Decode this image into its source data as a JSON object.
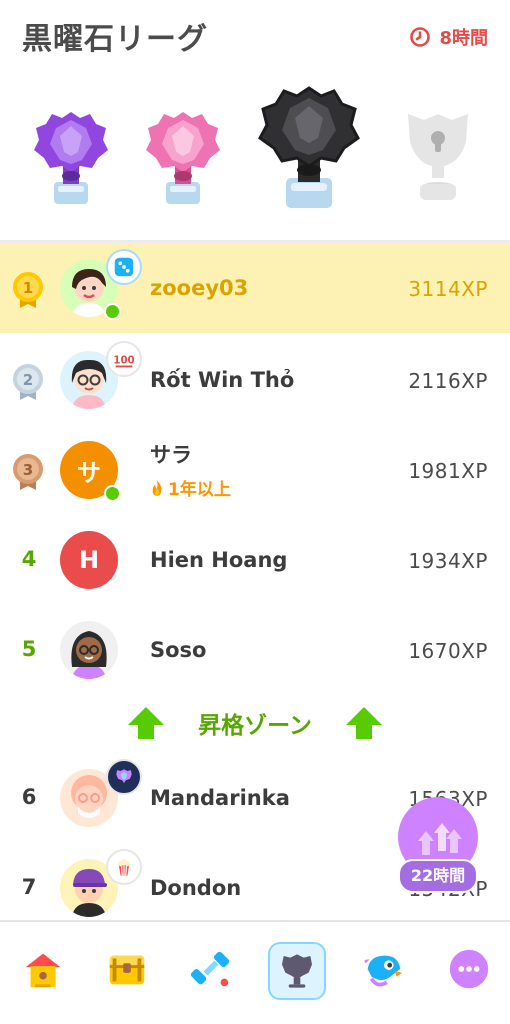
{
  "header": {
    "title": "黒曜石リーグ",
    "timer_label": "8時間",
    "timer_icon": "clock-icon",
    "accent_color": "#e34b4b"
  },
  "trophies": [
    {
      "name": "amethyst",
      "color": "#a56de2",
      "state": "past"
    },
    {
      "name": "pearl",
      "color": "#f07dbd",
      "state": "past"
    },
    {
      "name": "obsidian",
      "color": "#3c3c3c",
      "state": "current"
    },
    {
      "name": "diamond",
      "color": "#dadada",
      "state": "locked"
    }
  ],
  "leaderboard": [
    {
      "rank": "1",
      "name": "zooey03",
      "xp": "3114XP",
      "medal": "gold",
      "online": true,
      "badge": "dice-emoji",
      "highlight": true
    },
    {
      "rank": "2",
      "name": "Rốt Win Thỏ",
      "xp": "2116XP",
      "medal": "silver",
      "online": false,
      "badge": "100-emoji"
    },
    {
      "rank": "3",
      "name": "サラ",
      "xp": "1981XP",
      "medal": "bronze",
      "online": true,
      "streak": "1年以上",
      "avatar_letter": "サ",
      "avatar_color": "#f49000"
    },
    {
      "rank": "4",
      "name": "Hien Hoang",
      "xp": "1934XP",
      "avatar_letter": "H",
      "avatar_color": "#ea4b4b"
    },
    {
      "rank": "5",
      "name": "Soso",
      "xp": "1670XP"
    },
    {
      "rank": "6",
      "name": "Mandarinka",
      "xp": "1563XP",
      "badge": "league-trophy-badge"
    },
    {
      "rank": "7",
      "name": "Dondon",
      "xp": "1542XP",
      "badge": "popcorn-emoji"
    }
  ],
  "promotion_zone": {
    "label": "昇格ゾーン",
    "color": "#58a700"
  },
  "floating_timer": {
    "label": "22時間",
    "icon": "up-arrows-icon",
    "color": "#a56de2"
  },
  "bottom_nav": [
    {
      "name": "home",
      "icon": "house-icon"
    },
    {
      "name": "quests",
      "icon": "treasure-chest-icon"
    },
    {
      "name": "practice",
      "icon": "dumbbell-icon"
    },
    {
      "name": "leagues",
      "icon": "league-shield-icon",
      "active": true
    },
    {
      "name": "stories",
      "icon": "duo-bird-icon"
    },
    {
      "name": "more",
      "icon": "more-icon"
    }
  ]
}
